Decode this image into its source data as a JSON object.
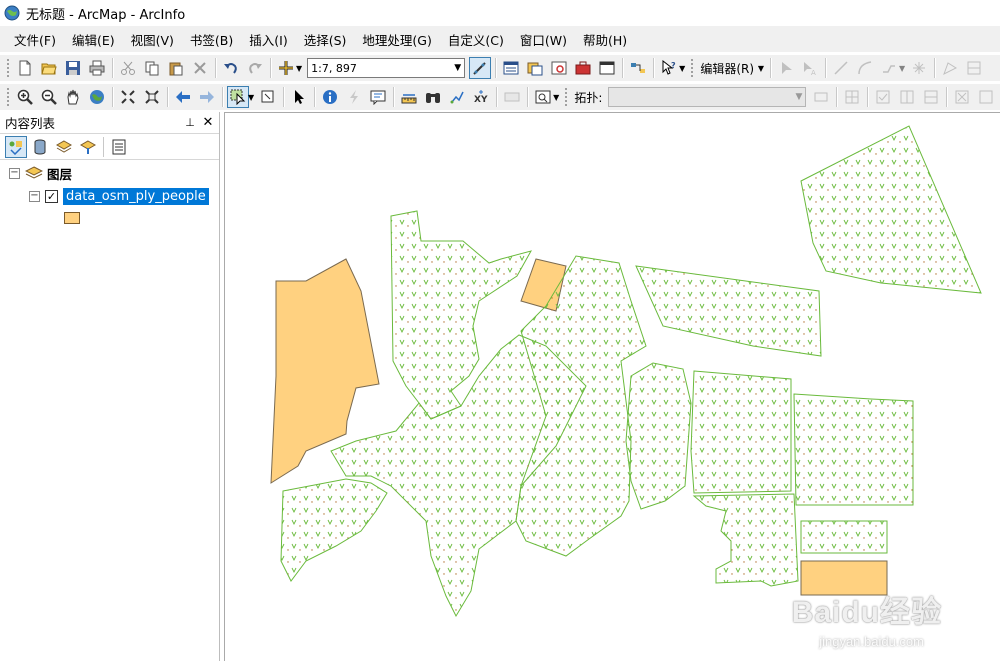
{
  "window": {
    "title": "无标题 - ArcMap - ArcInfo"
  },
  "menu": [
    "文件(F)",
    "编辑(E)",
    "视图(V)",
    "书签(B)",
    "插入(I)",
    "选择(S)",
    "地理处理(G)",
    "自定义(C)",
    "窗口(W)",
    "帮助(H)"
  ],
  "toolbar": {
    "scale_value": "1:7, 897",
    "editor_label": "编辑器(R)",
    "topology_label": "拓扑:"
  },
  "toc": {
    "title": "内容列表",
    "root_label": "图层",
    "layer_name": "data_osm_ply_people",
    "layer_checked": true,
    "symbol_color": "#ffd180"
  },
  "map": {
    "fill_color": "#ffd180",
    "outline_color": "#6aba3c",
    "pattern_color": "#6aba3c"
  },
  "watermark": {
    "main": "Baidu经验",
    "sub": "jingyan.baidu.com"
  }
}
